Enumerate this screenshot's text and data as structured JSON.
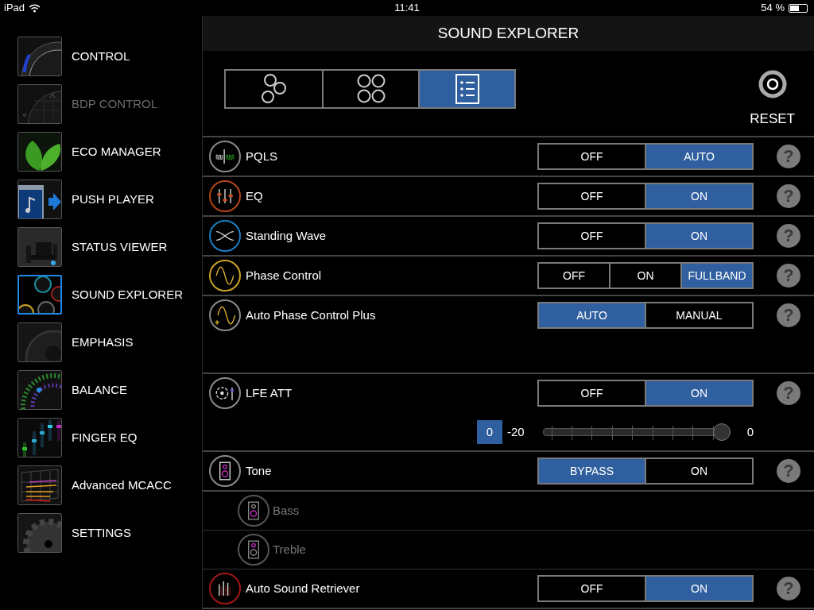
{
  "status_bar": {
    "carrier": "iPad",
    "time": "11:41",
    "battery": "54 %"
  },
  "sidebar": {
    "items": [
      {
        "label": "CONTROL",
        "selected": false,
        "disabled": false
      },
      {
        "label": "BDP CONTROL",
        "selected": false,
        "disabled": true
      },
      {
        "label": "ECO MANAGER",
        "selected": false,
        "disabled": false
      },
      {
        "label": "PUSH PLAYER",
        "selected": false,
        "disabled": false
      },
      {
        "label": "STATUS VIEWER",
        "selected": false,
        "disabled": false
      },
      {
        "label": "SOUND EXPLORER",
        "selected": true,
        "disabled": false
      },
      {
        "label": "EMPHASIS",
        "selected": false,
        "disabled": false
      },
      {
        "label": "BALANCE",
        "selected": false,
        "disabled": false
      },
      {
        "label": "FINGER EQ",
        "selected": false,
        "disabled": false
      },
      {
        "label": "Advanced MCACC",
        "selected": false,
        "disabled": false
      },
      {
        "label": "SETTINGS",
        "selected": false,
        "disabled": false
      }
    ]
  },
  "header": {
    "title": "SOUND EXPLORER"
  },
  "view_switch": [
    {
      "kind": "cluster",
      "selected": false
    },
    {
      "kind": "grid",
      "selected": false
    },
    {
      "kind": "list",
      "selected": true
    }
  ],
  "reset": {
    "label": "RESET"
  },
  "rows": [
    {
      "kind": "toggle",
      "color": "#8a8a8a",
      "label": "PQLS",
      "help": "?",
      "options": [
        {
          "label": "OFF",
          "selected": false
        },
        {
          "label": "AUTO",
          "selected": true
        }
      ]
    },
    {
      "kind": "toggle",
      "color": "#b5441a",
      "label": "EQ",
      "help": "?",
      "options": [
        {
          "label": "OFF",
          "selected": false
        },
        {
          "label": "ON",
          "selected": true
        }
      ]
    },
    {
      "kind": "toggle",
      "color": "#1b7ec4",
      "label": "Standing Wave",
      "help": "?",
      "options": [
        {
          "label": "OFF",
          "selected": false
        },
        {
          "label": "ON",
          "selected": true
        }
      ]
    },
    {
      "kind": "toggle",
      "color": "#c9a227",
      "label": "Phase Control",
      "help": "?",
      "options": [
        {
          "label": "OFF",
          "selected": false
        },
        {
          "label": "ON",
          "selected": false
        },
        {
          "label": "FULLBAND",
          "selected": true
        }
      ]
    },
    {
      "kind": "tall",
      "color": "#8a8a8a",
      "label": "Auto Phase Control Plus",
      "help": "?",
      "options": [
        {
          "label": "AUTO",
          "selected": true
        },
        {
          "label": "MANUAL",
          "selected": false
        }
      ]
    },
    {
      "kind": "slider",
      "color": "#8a8a8a",
      "label": "LFE ATT",
      "help": "?",
      "options": [
        {
          "label": "OFF",
          "selected": false
        },
        {
          "label": "ON",
          "selected": true
        }
      ],
      "slider": {
        "value": "0",
        "min": "-20",
        "max": "0",
        "level": 1
      }
    },
    {
      "kind": "toggle",
      "color": "#8a8a8a",
      "label": "Tone",
      "help": "?",
      "options": [
        {
          "label": "BYPASS",
          "selected": true
        },
        {
          "label": "ON",
          "selected": false
        }
      ]
    },
    {
      "kind": "sub",
      "color": "#555555",
      "label": "Bass",
      "disabled": true
    },
    {
      "kind": "sub",
      "color": "#555555",
      "label": "Treble",
      "disabled": true
    },
    {
      "kind": "toggle",
      "color": "#a01818",
      "label": "Auto Sound Retriever",
      "help": "?",
      "options": [
        {
          "label": "OFF",
          "selected": false
        },
        {
          "label": "ON",
          "selected": true
        }
      ]
    }
  ]
}
